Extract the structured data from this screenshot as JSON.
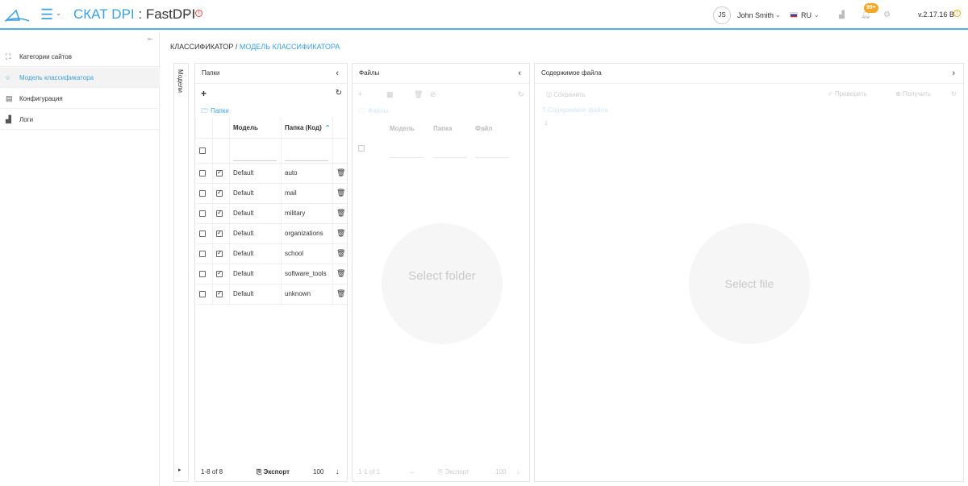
{
  "header": {
    "brand": "СКАТ DPI",
    "separator": " : ",
    "product": "FastDPI",
    "user_initials": "JS",
    "user_name": "John Smith",
    "language": "RU",
    "notifications_badge": "99+",
    "version": "v.2.17.16 B",
    "accent_color": "#3b9fe0"
  },
  "sidebar": {
    "items": [
      {
        "label": "Категории сайтов",
        "icon": "sitemap-icon",
        "active": false
      },
      {
        "label": "Модель классификатора",
        "icon": "circle-icon",
        "active": true
      },
      {
        "label": "Конфигурация",
        "icon": "list-icon",
        "active": false
      },
      {
        "label": "Логи",
        "icon": "chart-icon",
        "active": false
      }
    ]
  },
  "breadcrumb": {
    "root": "КЛАССИФИКАТОР",
    "separator": " / ",
    "current": "МОДЕЛЬ КЛАССИФИКАТОРА"
  },
  "models_strip": {
    "label": "Модели"
  },
  "folders": {
    "title": "Папки",
    "link": "Папки",
    "columns": {
      "model": "Модель",
      "folder": "Папка (Код)"
    },
    "rows": [
      {
        "model": "Default",
        "folder": "auto"
      },
      {
        "model": "Default",
        "folder": "mail"
      },
      {
        "model": "Default",
        "folder": "military"
      },
      {
        "model": "Default",
        "folder": "organizations"
      },
      {
        "model": "Default",
        "folder": "school"
      },
      {
        "model": "Default",
        "folder": "software_tools"
      },
      {
        "model": "Default",
        "folder": "unknown"
      }
    ],
    "footer": {
      "pagination": "1-8 of 8",
      "export": "Экспорт",
      "per_page": "100"
    }
  },
  "files": {
    "title": "Файлы",
    "link": "Файлы",
    "columns": {
      "model": "Модель",
      "folder": "Папка",
      "file": "Файл"
    },
    "placeholder": "Select folder",
    "footer": {
      "pagination": "1-1 of 1",
      "export": "Экспорт",
      "per_page": "100"
    }
  },
  "content": {
    "title": "Содержимое файла",
    "save": "Сохранить",
    "check": "Проверить",
    "fetch": "Получить",
    "link": "Содержимое файла",
    "line_number": "1",
    "placeholder": "Select file"
  }
}
